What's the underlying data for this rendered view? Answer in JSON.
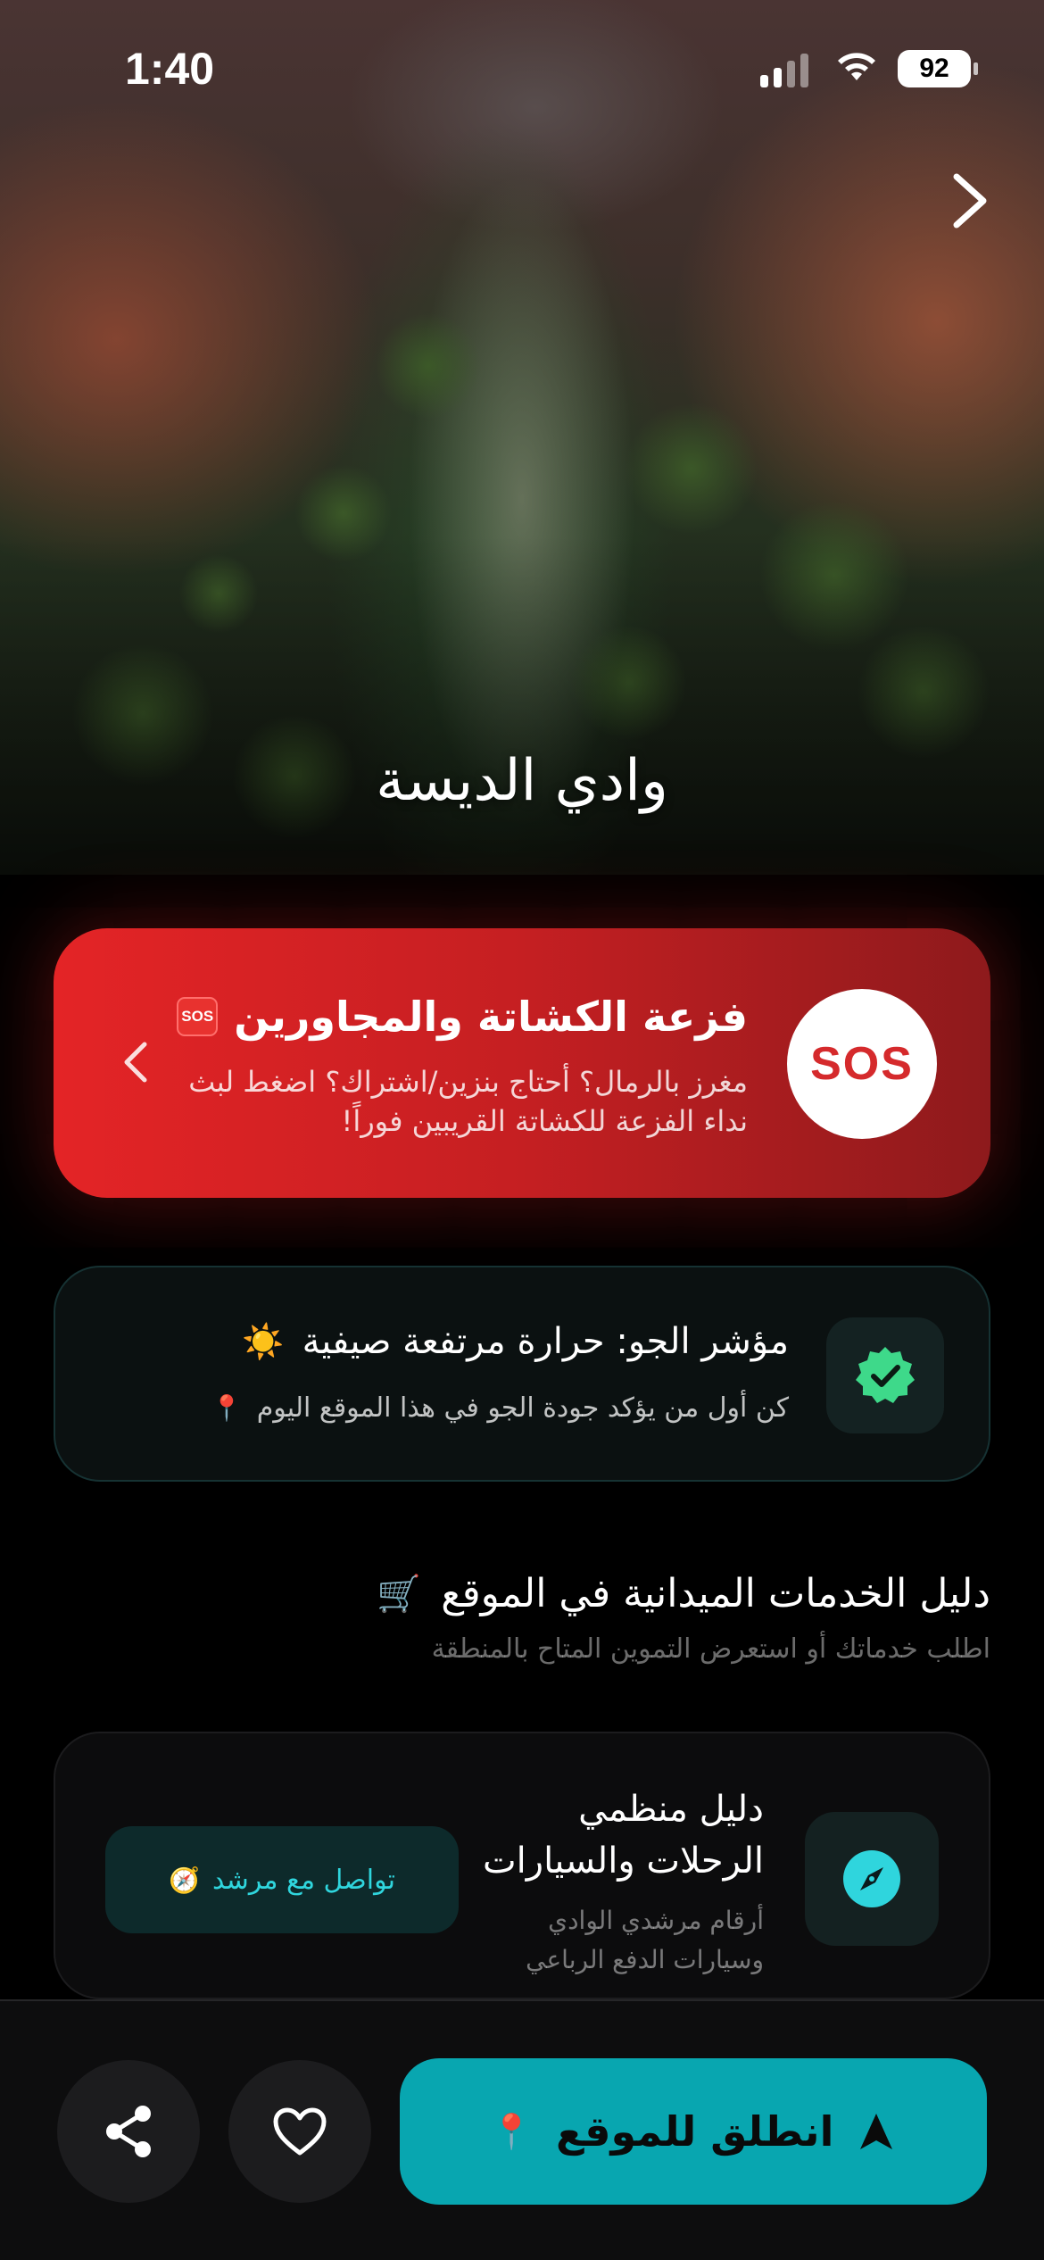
{
  "status_bar": {
    "time": "1:40",
    "battery": "92"
  },
  "hero": {
    "title": "وادي الديسة"
  },
  "sos_card": {
    "circle_label": "SOS",
    "badge": "SOS",
    "title": "فزعة الكشاتة والمجاورين",
    "description": "مغرز بالرمال؟ أحتاج بنزين/اشتراك؟ اضغط لبث نداء الفزعة للكشاتة القريبين فوراً!",
    "accent_color": "#e42426"
  },
  "weather_card": {
    "title": "مؤشر الجو: حرارة مرتفعة صيفية",
    "title_emoji": "☀️",
    "subtitle": "كن أول من يؤكد جودة الجو في هذا الموقع اليوم",
    "subtitle_emoji": "📍",
    "icon": "verified-badge-icon"
  },
  "services_section": {
    "title": "دليل الخدمات الميدانية في الموقع",
    "title_emoji": "🛒",
    "subtitle": "اطلب خدماتك أو استعرض التموين المتاح بالمنطقة"
  },
  "service_card": {
    "title": "دليل منظمي الرحلات والسيارات",
    "subtitle": "أرقام مرشدي الوادي وسيارات الدفع الرباعي",
    "button_label": "تواصل مع مرشد",
    "button_emoji": "🧭",
    "icon": "compass-icon",
    "accent_color": "#2fd5dd"
  },
  "bottom_bar": {
    "go_label": "انطلق للموقع",
    "go_emoji": "📍",
    "go_color": "#08a6b0"
  }
}
